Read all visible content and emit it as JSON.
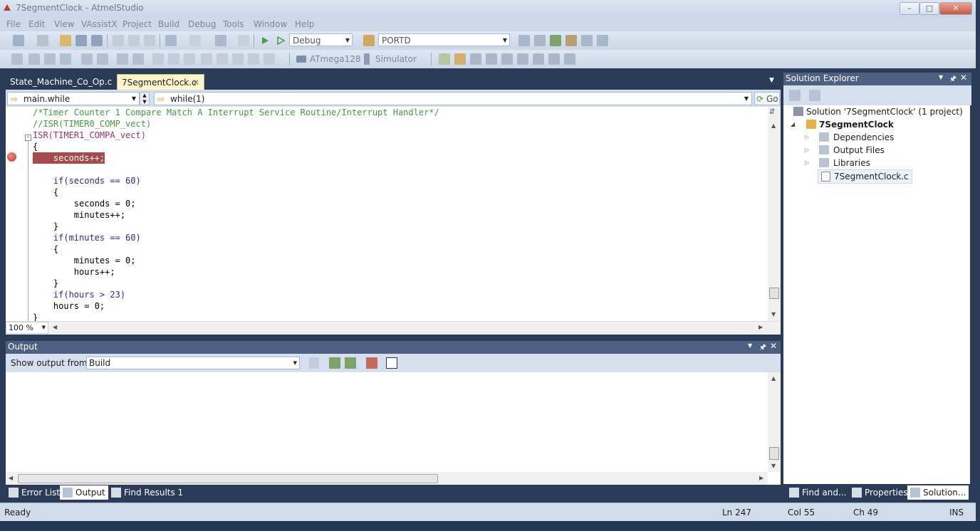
{
  "window": {
    "title": "7SegmentClock - AtmelStudio"
  },
  "menu": [
    "File",
    "Edit",
    "View",
    "VAssistX",
    "Project",
    "Build",
    "Debug",
    "Tools",
    "Window",
    "Help"
  ],
  "toolbar": {
    "config_value": "Debug",
    "port_value": "PORTD",
    "device_label": "ATmega128",
    "tool_label": "Simulator"
  },
  "editor": {
    "tabs": [
      {
        "label": "State_Machine_Co_Op.c",
        "active": false
      },
      {
        "label": "7SegmentClock.c",
        "active": true
      }
    ],
    "nav_scope": "main.while",
    "nav_member": "while(1)",
    "go_label": "Go",
    "zoom": "100 %",
    "lines": [
      "/*Timer Counter 1 Compare Match A Interrupt Service Routine/Interrupt Handler*/",
      "//ISR(TIMER0_COMP_vect)",
      "ISR(TIMER1_COMPA_vect)",
      "{",
      "    seconds++;",
      "",
      "    if(seconds == 60)",
      "    {",
      "        seconds = 0;",
      "        minutes++;",
      "    }",
      "    if(minutes == 60)",
      "    {",
      "        minutes = 0;",
      "        hours++;",
      "    }",
      "    if(hours > 23)",
      "    hours = 0;",
      "}"
    ]
  },
  "output": {
    "title": "Output",
    "show_from_label": "Show output from:",
    "show_from_value": "Build"
  },
  "bottom_tabs": [
    {
      "label": "Error List",
      "active": false
    },
    {
      "label": "Output",
      "active": true
    },
    {
      "label": "Find Results 1",
      "active": false
    }
  ],
  "solution_explorer": {
    "title": "Solution Explorer",
    "solution": "Solution '7SegmentClock' (1 project)",
    "project": "7SegmentClock",
    "folders": [
      "Dependencies",
      "Output Files",
      "Libraries"
    ],
    "file": "7SegmentClock.c",
    "tabs": [
      "Find and...",
      "Properties",
      "Solution..."
    ]
  },
  "status": {
    "text": "Ready",
    "ln": "Ln 247",
    "col": "Col 55",
    "ch": "Ch 49",
    "mode": "INS"
  },
  "colors": {
    "comment": "#3f9b3f",
    "macro": "#a0306b",
    "breakpoint": "#c0392b",
    "panel_header": "#4d6082"
  }
}
